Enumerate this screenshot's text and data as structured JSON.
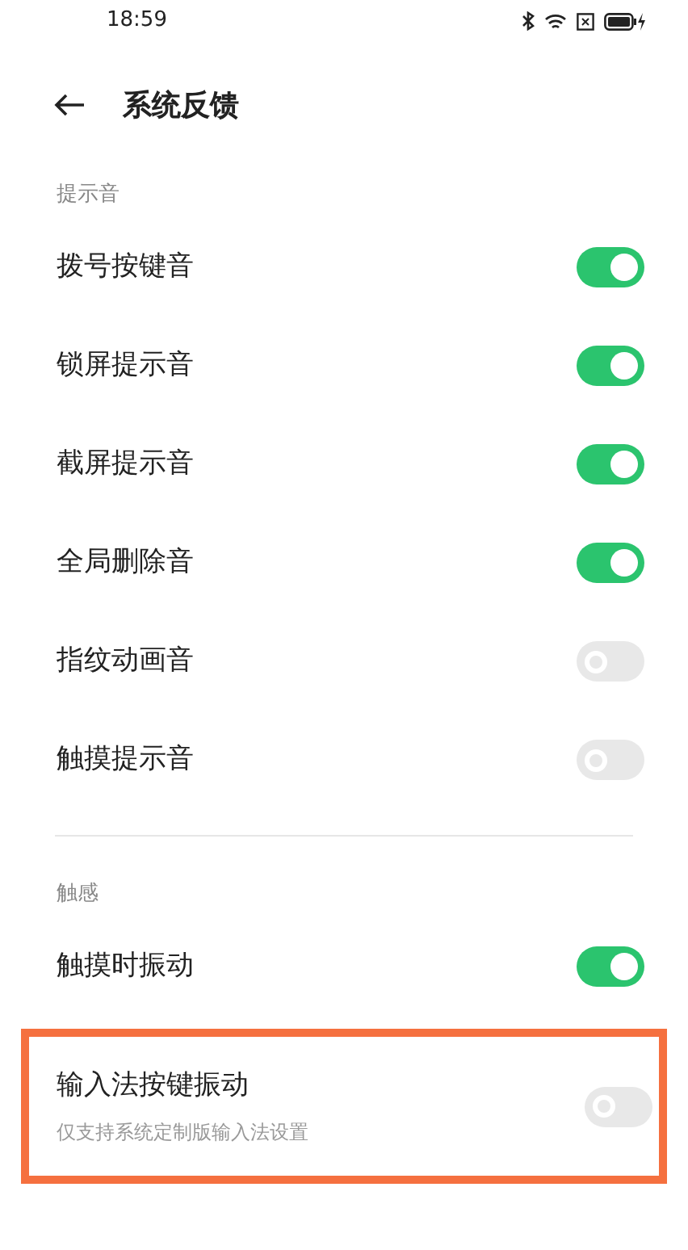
{
  "status_bar": {
    "time": "18:59"
  },
  "header": {
    "title": "系统反馈"
  },
  "sections": [
    {
      "title": "提示音",
      "items": [
        {
          "label": "拨号按键音",
          "on": true
        },
        {
          "label": "锁屏提示音",
          "on": true
        },
        {
          "label": "截屏提示音",
          "on": true
        },
        {
          "label": "全局删除音",
          "on": true
        },
        {
          "label": "指纹动画音",
          "on": false
        },
        {
          "label": "触摸提示音",
          "on": false
        }
      ]
    },
    {
      "title": "触感",
      "items": [
        {
          "label": "触摸时振动",
          "on": true
        },
        {
          "label": "输入法按键振动",
          "subtitle": "仅支持系统定制版输入法设置",
          "on": false,
          "highlighted": true
        }
      ]
    }
  ]
}
